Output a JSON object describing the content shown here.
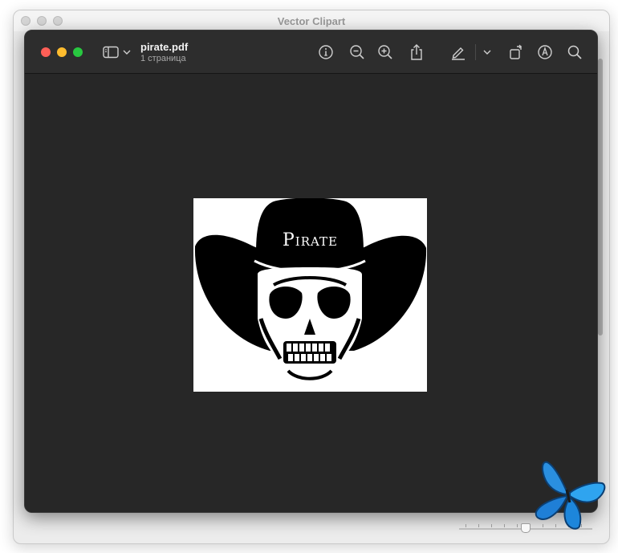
{
  "outer_window": {
    "title": "Vector Clipart"
  },
  "preview": {
    "file_name": "pirate.pdf",
    "page_count": "1 страница"
  },
  "document": {
    "hat_text": "Pirate"
  },
  "icons": {
    "sidebar": "sidebar-icon",
    "chevron": "chevron-down-icon",
    "info": "info-icon",
    "zoom_out": "zoom-out-icon",
    "zoom_in": "zoom-in-icon",
    "share": "share-icon",
    "highlight": "highlighter-icon",
    "rotate": "rotate-icon",
    "markup": "markup-icon",
    "search": "search-icon"
  },
  "colors": {
    "close": "#fe5f57",
    "minimize": "#febc2e",
    "zoom": "#28c840",
    "toolbar_bg": "#2d2d2d",
    "canvas_bg": "#272727"
  }
}
